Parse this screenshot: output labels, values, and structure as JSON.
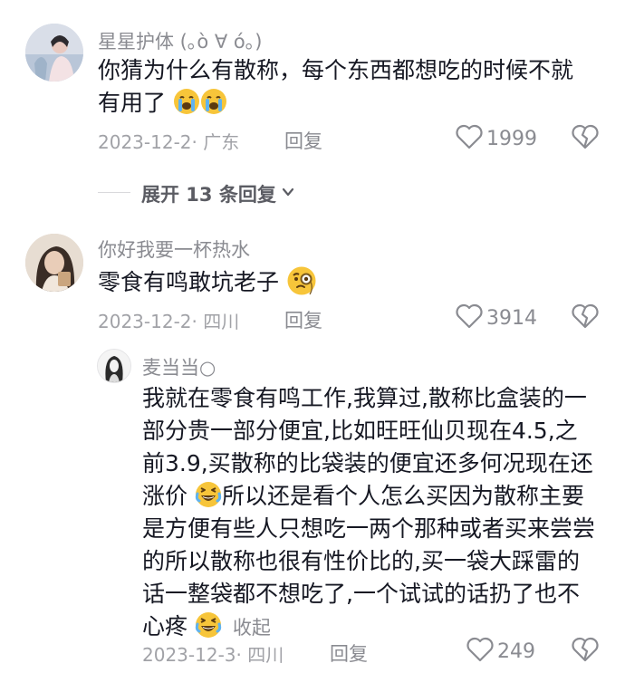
{
  "comments": [
    {
      "username": "星星护体 (｡ò ∀ ó｡)",
      "text": "你猜为什么有散称，每个东西都想吃的时候不就有用了",
      "date_location": "2023-12-2· 广东",
      "reply_label": "回复",
      "likes": "1999",
      "emoji": "crying-face"
    },
    {
      "username": "你好我要一杯热水",
      "text": "零食有鸣敢坑老子",
      "date_location": "2023-12-2· 四川",
      "reply_label": "回复",
      "likes": "3914",
      "emoji": "monocle-face"
    }
  ],
  "expand_label": "展开 13 条回复",
  "reply": {
    "username": "麦当当○",
    "text_a": "我就在零食有鸣工作,我算过,散称比盒装的一部分贵一部分便宜,比如旺旺仙贝现在4.5,之前3.9,买散称的比袋装的便宜还多何况现在还涨价",
    "text_b": "所以还是看个人怎么买因为散称主要是方便有些人只想吃一两个那种或者买来尝尝的所以散称也很有性价比的,买一袋大踩雷的话一整袋都不想吃了,一个试试的话扔了也不心疼",
    "collapse_label": "收起",
    "date_location": "2023-12-3· 四川",
    "reply_label": "回复",
    "likes": "249",
    "emoji": "laughing-crying-face"
  },
  "colors": {
    "text": "#161823",
    "muted": "#8a8b91",
    "emoji_yellow": "#f7c53a"
  }
}
